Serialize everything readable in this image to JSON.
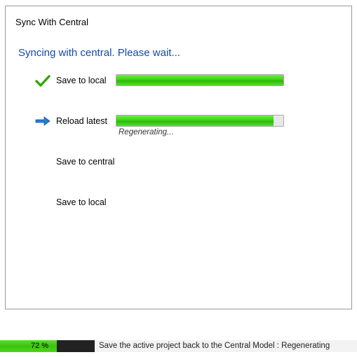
{
  "dialog": {
    "title": "Sync With Central",
    "message": "Syncing with central. Please wait..."
  },
  "steps": {
    "step1": {
      "label": "Save to local",
      "progress": 100,
      "state": "done"
    },
    "step2": {
      "label": "Reload latest",
      "progress": 94,
      "state": "active",
      "substatus": "Regenerating..."
    },
    "step3": {
      "label": "Save to central",
      "state": "pending"
    },
    "step4": {
      "label": "Save to local",
      "state": "pending"
    }
  },
  "statusbar": {
    "percent": 72,
    "percent_label": "72 %",
    "message": "Save the active project back to the Central Model : Regenerating"
  },
  "icons": {
    "check": "check-icon",
    "arrow": "arrow-right-icon"
  },
  "colors": {
    "accent_blue": "#114aab",
    "progress_green": "#3bd40f"
  }
}
